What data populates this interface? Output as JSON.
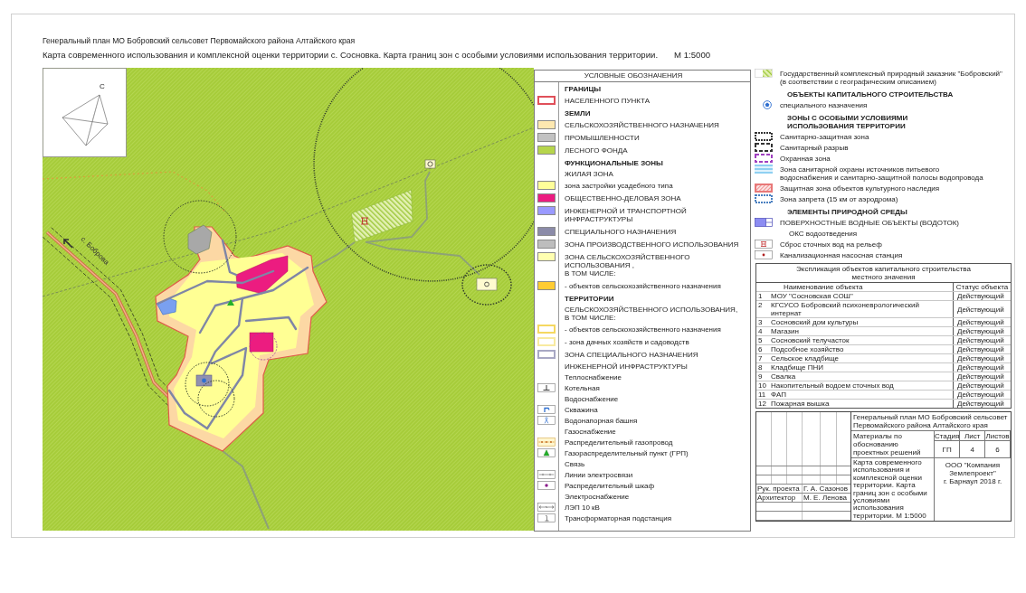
{
  "titles": {
    "plan": "Генеральный план МО Бобровский сельсовет Первомайского района Алтайского края",
    "map": "Карта современного использования и комплексной оценки территории с. Сосновка. Карта границ зон с особыми условиями использования территории.",
    "scale": "М 1:5000"
  },
  "map": {
    "compass_label": "С",
    "place_label": "с. Боброва"
  },
  "legend": {
    "title": "УСЛОВНЫЕ ОБОЗНАЧЕНИЯ",
    "items": [
      {
        "kind": "heading",
        "label": "ГРАНИЦЫ"
      },
      {
        "kind": "outline",
        "color": "#e0505a",
        "label": "НАСЕЛЕННОГО ПУНКТА"
      },
      {
        "kind": "heading",
        "label": "ЗЕМЛИ"
      },
      {
        "kind": "swatch",
        "color": "#fde8b0",
        "label": "СЕЛЬСКОХОЗЯЙСТВЕННОГО НАЗНАЧЕНИЯ"
      },
      {
        "kind": "swatch",
        "color": "#c2c2c2",
        "label": "ПРОМЫШЛЕННОСТИ"
      },
      {
        "kind": "swatch",
        "color": "#b6d54c",
        "label": "ЛЕСНОГО ФОНДА"
      },
      {
        "kind": "heading",
        "label": "ФУНКЦИОНАЛЬНЫЕ ЗОНЫ"
      },
      {
        "kind": "text",
        "label": "ЖИЛАЯ ЗОНА"
      },
      {
        "kind": "swatch",
        "color": "#ffff99",
        "label": "зона застройки усадебного типа"
      },
      {
        "kind": "swatch",
        "color": "#ec1c80",
        "label": "ОБЩЕСТВЕННО-ДЕЛОВАЯ ЗОНА"
      },
      {
        "kind": "swatch",
        "color": "#9a9aff",
        "label": "ИНЖЕНЕРНОЙ И ТРАНСПОРТНОЙ ИНФРАСТРУКТУРЫ"
      },
      {
        "kind": "swatch",
        "color": "#8b8ba8",
        "label": "СПЕЦИАЛЬНОГО НАЗНАЧЕНИЯ"
      },
      {
        "kind": "swatch",
        "color": "#bdbdbd",
        "label": "ЗОНА ПРОИЗВОДСТВЕННОГО ИСПОЛЬЗОВАНИЯ"
      },
      {
        "kind": "swatch",
        "color": "#ffffb0",
        "label": "ЗОНА СЕЛЬСКОХОЗЯЙСТВЕННОГО ИСПОЛЬЗОВАНИЯ ,\nВ ТОМ ЧИСЛЕ:"
      },
      {
        "kind": "swatch",
        "color": "#ffcc33",
        "label": "- объектов сельскохозяйственного назначения"
      },
      {
        "kind": "heading",
        "label": "ТЕРРИТОРИИ"
      },
      {
        "kind": "text",
        "label": "СЕЛЬСКОХОЗЯЙСТВЕННОГО ИСПОЛЬЗОВАНИЯ,\nВ ТОМ ЧИСЛЕ:"
      },
      {
        "kind": "outline",
        "color": "#f5d860",
        "label": "- объектов сельскохозяйственного назначения"
      },
      {
        "kind": "outline",
        "color": "#f8eaa0",
        "label": "- зона дачных хозяйств и садоводств"
      },
      {
        "kind": "outline",
        "color": "#a8a8c4",
        "label": "ЗОНА СПЕЦИАЛЬНОГО НАЗНАЧЕНИЯ"
      },
      {
        "kind": "text",
        "label": "ИНЖЕНЕРНОЙ ИНФРАСТРУКТУРЫ"
      },
      {
        "kind": "text",
        "label": "Теплоснабжение"
      },
      {
        "kind": "boiler",
        "label": "Котельная"
      },
      {
        "kind": "text",
        "label": "Водоснабжение"
      },
      {
        "kind": "well",
        "label": "Скважина"
      },
      {
        "kind": "tower",
        "label": "Водонапорная башня"
      },
      {
        "kind": "text",
        "label": "Газоснабжение"
      },
      {
        "kind": "gaspipe",
        "label": "Распределительный газопровод"
      },
      {
        "kind": "gasunit",
        "label": "Газораспределительный пункт (ГРП)"
      },
      {
        "kind": "text",
        "label": "Связь"
      },
      {
        "kind": "cable",
        "label": "Линии электросвязи"
      },
      {
        "kind": "cabinet",
        "label": "Распределительный шкаф"
      },
      {
        "kind": "text",
        "label": "Электроснабжение"
      },
      {
        "kind": "powerline",
        "label": "ЛЭП 10 кВ"
      },
      {
        "kind": "substation",
        "label": "Трансформаторная подстанция"
      }
    ]
  },
  "legend_extra": {
    "items": [
      {
        "kind": "reserve",
        "label": "Государственный комплексный природный заказник \"Бобровский\"\n(в соответствии с географическим описанием)"
      },
      {
        "kind": "heading",
        "label": "ОБЪЕКТЫ КАПИТАЛЬНОГО СТРОИТЕЛЬСТВА"
      },
      {
        "kind": "special",
        "label": "специального назначения"
      },
      {
        "kind": "heading",
        "label": "ЗОНЫ С ОСОБЫМИ УСЛОВИЯМИ\nИСПОЛЬЗОВАНИЯ ТЕРРИТОРИИ"
      },
      {
        "kind": "dotted",
        "color": "#333333",
        "label": "Санитарно-защитная зона"
      },
      {
        "kind": "dashed",
        "color": "#333333",
        "label": "Санитарный разрыв"
      },
      {
        "kind": "dashed",
        "color": "#a040c0",
        "label": "Охранная зона"
      },
      {
        "kind": "striped",
        "color": "#8fd0f2",
        "label": "Зона санитарной охраны источников питьевого\nводоснабжения и санитарно-защитной полосы водопровода"
      },
      {
        "kind": "hatched",
        "color": "#e87878",
        "label": "Защитная зона объектов культурного наследия"
      },
      {
        "kind": "dotted",
        "color": "#4a7fc0",
        "label": "Зона запрета (15 км от аэродрома)"
      },
      {
        "kind": "heading",
        "label": "ЭЛЕМЕНТЫ ПРИРОДНОЙ СРЕДЫ"
      },
      {
        "kind": "water",
        "label": "ПОВЕРХНОСТНЫЕ ВОДНЫЕ ОБЪЕКТЫ (ВОДОТОК)"
      },
      {
        "kind": "text",
        "label": "ОКС водоотведения"
      },
      {
        "kind": "outfall",
        "label": "Сброс сточных вод на рельеф"
      },
      {
        "kind": "pump",
        "label": "Канализационная насосная станция"
      }
    ]
  },
  "explication": {
    "title": "Экспликация объектов капитального строительства\nместного значения",
    "columns": [
      "Наименование объекта",
      "Статус объекта"
    ],
    "rows": [
      {
        "number": "1",
        "name": "МОУ \"Сосновская СОШ\"",
        "status": "Действующий"
      },
      {
        "number": "2",
        "name": "КГСУСО Бобровский психоневрологический интернат",
        "status": "Действующий"
      },
      {
        "number": "3",
        "name": "Сосновский дом культуры",
        "status": "Действующий"
      },
      {
        "number": "4",
        "name": "Магазин",
        "status": "Действующий"
      },
      {
        "number": "5",
        "name": "Сосновский телучасток",
        "status": "Действующий"
      },
      {
        "number": "6",
        "name": "Подсобное хозяйство",
        "status": "Действующий"
      },
      {
        "number": "7",
        "name": "Сельское кладбище",
        "status": "Действующий"
      },
      {
        "number": "8",
        "name": "Кладбище ПНИ",
        "status": "Действующий"
      },
      {
        "number": "9",
        "name": "Свалка",
        "status": "Действующий"
      },
      {
        "number": "10",
        "name": "Накопительный водоем сточных вод",
        "status": "Действующий"
      },
      {
        "number": "11",
        "name": "ФАП",
        "status": "Действующий"
      },
      {
        "number": "12",
        "name": "Пожарная вышка",
        "status": "Действующий"
      }
    ]
  },
  "title_block": {
    "signatures": [
      {
        "role": "Рук. проекта",
        "name": "Г. А. Сазонов"
      },
      {
        "role": "Архитектор",
        "name": "М. Е. Ленова"
      }
    ],
    "project": "Генеральный план МО Бобровский сельсовет\nПервомайского района Алтайского края",
    "volume": "Материалы по обоснованию\nпроектных решений",
    "sheet_headers": [
      "Стадия",
      "Лист",
      "Листов"
    ],
    "sheet_values": [
      "ГП",
      "4",
      "6"
    ],
    "drawing": "Карта современного использования и комплексной оценки территории. Карта границ зон с особыми условиями использования территории. М 1:5000",
    "company": "ООО \"Компания Землепроект\"\nг. Барнаул 2018 г."
  }
}
